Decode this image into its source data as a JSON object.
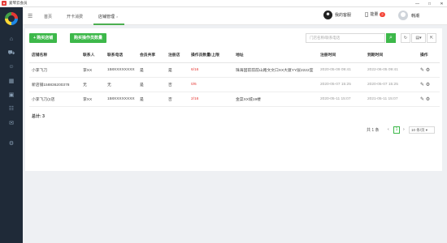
{
  "window": {
    "title": "爱琴云会员",
    "controls": [
      "—",
      "□",
      "✕"
    ]
  },
  "sidebar": {
    "icons": [
      "home-icon",
      "cart-icon",
      "people-icon",
      "grid-icon",
      "gift-icon",
      "user-card-icon",
      "mail-icon",
      "settings-icon"
    ]
  },
  "topbar": {
    "tabs": [
      {
        "label": "首页"
      },
      {
        "label": "开卡消费"
      },
      {
        "label": "店铺管理",
        "close": "×"
      }
    ],
    "customer_service": "我的客服",
    "notice": "能量",
    "notice_count": "2",
    "username": "韩潮"
  },
  "toolbar": {
    "add_store": "+ 购买店铺",
    "buy_quota": "购买操作员数量",
    "search_placeholder": "门店名称/联系电话",
    "search_icon": "⌕",
    "refresh": "↻",
    "view": "▤▾",
    "export": "⇱"
  },
  "table": {
    "headers": [
      "店铺名称",
      "联系人",
      "联系电话",
      "会员共享",
      "注册店",
      "操作员数量/上限",
      "地址",
      "注册时间",
      "到期时间",
      "操作"
    ],
    "rows": [
      {
        "name": "小李飞刀",
        "contact": "李XX",
        "phone": "158XXXXXXXX",
        "share": "是",
        "reg_store": "是",
        "ops_used": "6",
        "ops_limit": "/16",
        "address": "珠海固前前前山路文文口XX大厦YY层2222室",
        "reg_time": "2020-05-09 09:41",
        "expire": "2022-06-05 09:41"
      },
      {
        "name": "新店铺158836200378",
        "contact": "无",
        "phone": "无",
        "share": "是",
        "reg_store": "否",
        "ops_used": "0",
        "ops_limit": "/6",
        "address": "",
        "reg_time": "2020-05-07 15:25",
        "expire": "2020-05-07 15:25"
      },
      {
        "name": "小李飞刀(2店",
        "contact": "李XX",
        "phone": "158XXXXXXXX",
        "share": "是",
        "reg_store": "否",
        "ops_used": "2",
        "ops_limit": "/16",
        "address": "金菜XX城19楼",
        "reg_time": "2020-05-11 15:07",
        "expire": "2021-05-11 15:07"
      }
    ],
    "edit_icon": "✎",
    "delete_icon": "⚙"
  },
  "footer": {
    "total_label": "总计:",
    "total_value": "3",
    "pager_text": "共 1 条",
    "prev": "‹",
    "page": "1",
    "next": "›",
    "page_size": "10 条/页 ▾"
  },
  "colors": {
    "accent": "#3db84a",
    "sidebar": "#1f2a38",
    "danger": "#e53935"
  }
}
